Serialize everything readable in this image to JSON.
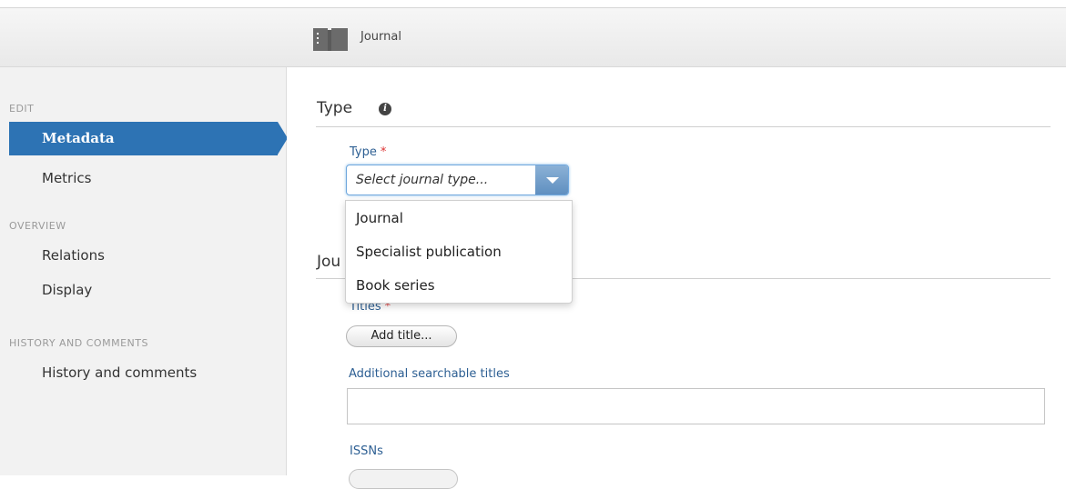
{
  "header": {
    "title": "Journal",
    "icon": "journal-book-icon"
  },
  "sidebar": {
    "edit_heading": "EDIT",
    "metadata": "Metadata",
    "metrics": "Metrics",
    "overview_heading": "OVERVIEW",
    "relations": "Relations",
    "display": "Display",
    "history_heading": "HISTORY AND COMMENTS",
    "history": "History and comments"
  },
  "main": {
    "type_section": "Type",
    "type_label": "Type",
    "required_mark": "*",
    "type_placeholder": "Select journal type...",
    "type_options": [
      "Journal",
      "Specialist publication",
      "Book series"
    ],
    "journal_section_partial": "Jou",
    "titles_label": "Titles",
    "add_title_button": "Add title...",
    "additional_titles_label": "Additional searchable titles",
    "issns_label": "ISSNs"
  },
  "colors": {
    "accent": "#2d73b4",
    "label": "#2d5f93",
    "required": "#dd3333"
  }
}
